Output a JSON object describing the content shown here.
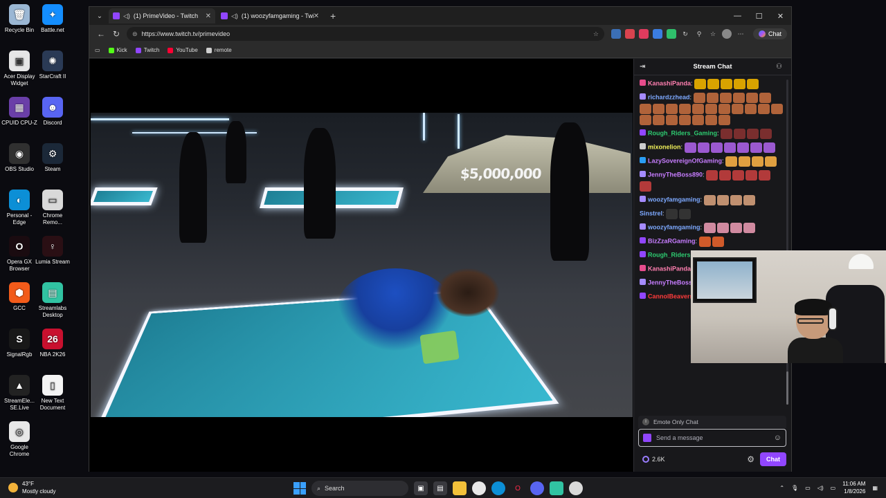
{
  "desktop": {
    "icons": [
      {
        "label": "Recycle Bin",
        "color": "#9bb7d4",
        "glyph": "🗑"
      },
      {
        "label": "Battle.net",
        "color": "#148eff",
        "glyph": "✦"
      },
      {
        "label": "Acer Display Widget",
        "color": "#e6e6e6",
        "glyph": "▣"
      },
      {
        "label": "StarCraft II",
        "color": "#2a3a55",
        "glyph": "✺"
      },
      {
        "label": "CPUID CPU-Z",
        "color": "#6a3fa8",
        "glyph": "▦"
      },
      {
        "label": "Discord",
        "color": "#5865f2",
        "glyph": "☻"
      },
      {
        "label": "OBS Studio",
        "color": "#303030",
        "glyph": "◉"
      },
      {
        "label": "Steam",
        "color": "#1b2838",
        "glyph": "⚙"
      },
      {
        "label": "Personal - Edge",
        "color": "#0c8fd6",
        "glyph": "◐"
      },
      {
        "label": "Chrome Remo...",
        "color": "#d9d9d9",
        "glyph": "▭"
      },
      {
        "label": "Opera GX Browser",
        "color": "#1a0b10",
        "glyph": "O"
      },
      {
        "label": "Lumia Stream",
        "color": "#2a0f14",
        "glyph": "♀"
      },
      {
        "label": "GCC",
        "color": "#f25b1a",
        "glyph": "⬢"
      },
      {
        "label": "Streamlabs Desktop",
        "color": "#31c3a2",
        "glyph": "▤"
      },
      {
        "label": "SignalRgb",
        "color": "#181818",
        "glyph": "S"
      },
      {
        "label": "NBA 2K26",
        "color": "#c8102e",
        "glyph": "26"
      },
      {
        "label": "StreamEle... SE.Live",
        "color": "#222",
        "glyph": "▲"
      },
      {
        "label": "New Text Document",
        "color": "#f4f4f4",
        "glyph": "▯"
      },
      {
        "label": "Google Chrome",
        "color": "#e8e8e8",
        "glyph": "◎"
      }
    ]
  },
  "browser": {
    "tabs": [
      {
        "title": "(1) PrimeVideo - Twitch",
        "active": true
      },
      {
        "title": "(1) woozyfamgaming - Twitch",
        "active": false
      }
    ],
    "url": "https://www.twitch.tv/primevideo",
    "copilot_label": "Chat",
    "bookmarks": [
      {
        "label": "Kick",
        "color": "#53fc18"
      },
      {
        "label": "Twitch",
        "color": "#9146ff"
      },
      {
        "label": "YouTube",
        "color": "#ff0033"
      },
      {
        "label": "remote",
        "color": "#cfcfcf"
      }
    ]
  },
  "video": {
    "prize_text": "$5,000,000"
  },
  "chat": {
    "title": "Stream Chat",
    "messages": [
      {
        "user": "KanashiPanda",
        "color": "#ff7fb0",
        "badge": "#e74c8c",
        "emotes": 5,
        "ecolor": "#d8a300"
      },
      {
        "user": "richardzzhead",
        "color": "#7da9ff",
        "badge": "#a58bff",
        "emotes": 24,
        "ecolor": "#b0633a"
      },
      {
        "user": "Rough_Riders_Gaming",
        "color": "#2ecc71",
        "badge": "#9146ff",
        "emotes": 4,
        "ecolor": "#7a2e2e"
      },
      {
        "user": "mixonelion",
        "color": "#f2f25a",
        "badge": "#cccccc",
        "emotes": 7,
        "ecolor": "#9b59d0"
      },
      {
        "user": "LazySovereignOfGaming",
        "color": "#c77dff",
        "badge": "#2a9df4",
        "emotes": 4,
        "ecolor": "#e0a040"
      },
      {
        "user": "JennyTheBoss890",
        "color": "#c77dff",
        "badge": "#a58bff",
        "emotes": 6,
        "ecolor": "#b23a3a"
      },
      {
        "user": "woozyfamgaming",
        "color": "#7da9ff",
        "badge": "#a58bff",
        "emotes": 4,
        "ecolor": "#c09070"
      },
      {
        "user": "Sinstrel",
        "color": "#7da9ff",
        "badge": "",
        "emotes": 2,
        "ecolor": "#333"
      },
      {
        "user": "woozyfamgaming",
        "color": "#7da9ff",
        "badge": "#a58bff",
        "emotes": 4,
        "ecolor": "#d08aa0"
      },
      {
        "user": "BizZzaRGaming",
        "color": "#c77dff",
        "badge": "#9146ff",
        "emotes": 2,
        "ecolor": "#d05a2a"
      },
      {
        "user": "Rough_Riders_Gaming",
        "color": "#2ecc71",
        "badge": "#9146ff",
        "emotes": 2,
        "ecolor": "#7a2e2e"
      },
      {
        "user": "KanashiPanda",
        "color": "#ff7fb0",
        "badge": "#e74c8c",
        "emotes": 5,
        "ecolor": "#d8a300"
      },
      {
        "user": "JennyTheBoss890",
        "color": "#c77dff",
        "badge": "#a58bff",
        "emotes": 5,
        "ecolor": "#b23a3a"
      },
      {
        "user": "CannolBeavers",
        "color": "#ff3b3b",
        "badge": "#9146ff",
        "emotes": 3,
        "ecolor": "#e0b800"
      }
    ],
    "emote_only_label": "Emote Only Chat",
    "input_placeholder": "Send a message",
    "points": "2.6K",
    "chat_button": "Chat"
  },
  "taskbar": {
    "temperature": "43°F",
    "weather": "Mostly cloudy",
    "search_label": "Search",
    "time": "11:06 AM",
    "date": "1/8/2026"
  }
}
